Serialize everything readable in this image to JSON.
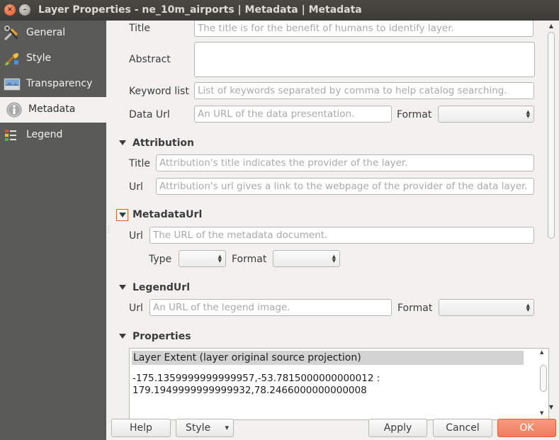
{
  "window": {
    "title": "Layer Properties - ne_10m_airports | Metadata | Metadata",
    "close_glyph": "×",
    "min_glyph": "–"
  },
  "sidebar": {
    "items": [
      {
        "label": "General",
        "icon": "tools-icon"
      },
      {
        "label": "Style",
        "icon": "paintbrush-icon"
      },
      {
        "label": "Transparency",
        "icon": "transparency-icon"
      },
      {
        "label": "Metadata",
        "icon": "info-icon",
        "active": true
      },
      {
        "label": "Legend",
        "icon": "legend-icon"
      }
    ]
  },
  "description": {
    "title_label": "Title",
    "title_placeholder": "The title is for the benefit of humans to identify layer.",
    "abstract_label": "Abstract",
    "keyword_label": "Keyword list",
    "keyword_placeholder": "List of keywords separated by comma to help catalog searching.",
    "dataurl_label": "Data Url",
    "dataurl_placeholder": "An URL of the data presentation.",
    "format_label": "Format",
    "format_value": ""
  },
  "attribution": {
    "header": "Attribution",
    "title_label": "Title",
    "title_placeholder": "Attribution's title indicates the provider of the layer.",
    "url_label": "Url",
    "url_placeholder": "Attribution's url gives a link to the webpage of the provider of the data layer."
  },
  "metadataurl": {
    "header": "MetadataUrl",
    "url_label": "Url",
    "url_placeholder": "The URL of the metadata document.",
    "type_label": "Type",
    "type_value": "",
    "format_label": "Format",
    "format_value": ""
  },
  "legendurl": {
    "header": "LegendUrl",
    "url_label": "Url",
    "url_placeholder": "An URL of the legend image.",
    "format_label": "Format",
    "format_value": ""
  },
  "properties": {
    "header": "Properties",
    "extent_heading": "Layer Extent (layer original source projection)",
    "extent_line1": "-175.1359999999999957,-53.7815000000000012 :",
    "extent_line2": "179.1949999999999932,78.2466000000000008"
  },
  "buttons": {
    "help": "Help",
    "style": "Style",
    "style_arrow": "▾",
    "apply": "Apply",
    "cancel": "Cancel",
    "ok": "OK"
  },
  "colors": {
    "sidebar_bg": "#5a5a59",
    "ok_accent": "#ef7d5e",
    "titlebar_bg": "#3c3b37"
  }
}
